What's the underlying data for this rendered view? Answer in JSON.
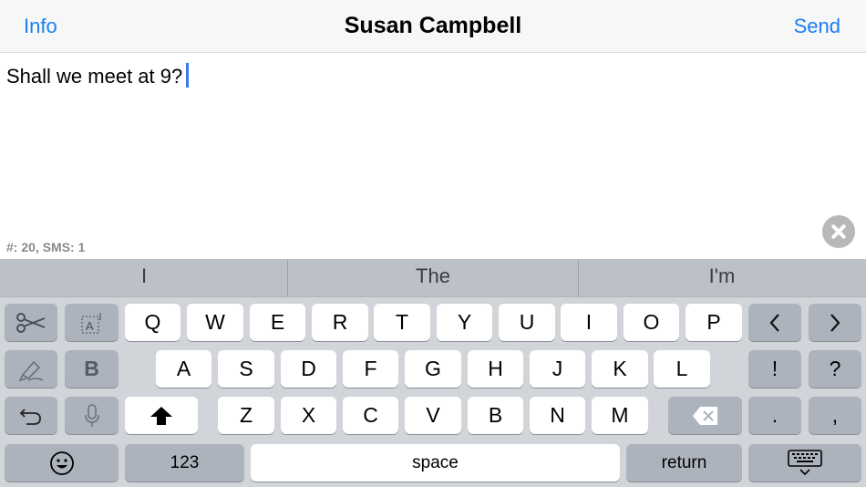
{
  "navbar": {
    "left_label": "Info",
    "title": "Susan Campbell",
    "right_label": "Send"
  },
  "editor": {
    "text": "Shall we meet at 9?",
    "counter": "#: 20, SMS: 1"
  },
  "predictions": [
    "I",
    "The",
    "I'm"
  ],
  "keys": {
    "row1": [
      "Q",
      "W",
      "E",
      "R",
      "T",
      "Y",
      "U",
      "I",
      "O",
      "P"
    ],
    "row2": [
      "A",
      "S",
      "D",
      "F",
      "G",
      "H",
      "J",
      "K",
      "L"
    ],
    "row3": [
      "Z",
      "X",
      "C",
      "V",
      "B",
      "N",
      "M"
    ],
    "left_prev": "<",
    "right_next": ">",
    "exclaim": "!",
    "question": "?",
    "period": ".",
    "comma": ",",
    "bold_b": "B",
    "numbers": "123",
    "space": "space",
    "return": "return"
  },
  "icons": {
    "cut": "scissors-icon",
    "select_all": "text-select-icon",
    "highlight": "highlighter-icon",
    "undo": "undo-icon",
    "dictation": "microphone-icon",
    "shift": "shift-arrow-icon",
    "backspace": "backspace-icon",
    "emoji": "emoji-icon",
    "hide_keyboard": "keyboard-dismiss-icon",
    "clear": "clear-x-icon"
  },
  "colors": {
    "accent": "#1a7ef2",
    "caret": "#3478f6",
    "keyboard_bg": "#d1d4d9",
    "dark_key": "#acb3bd"
  }
}
